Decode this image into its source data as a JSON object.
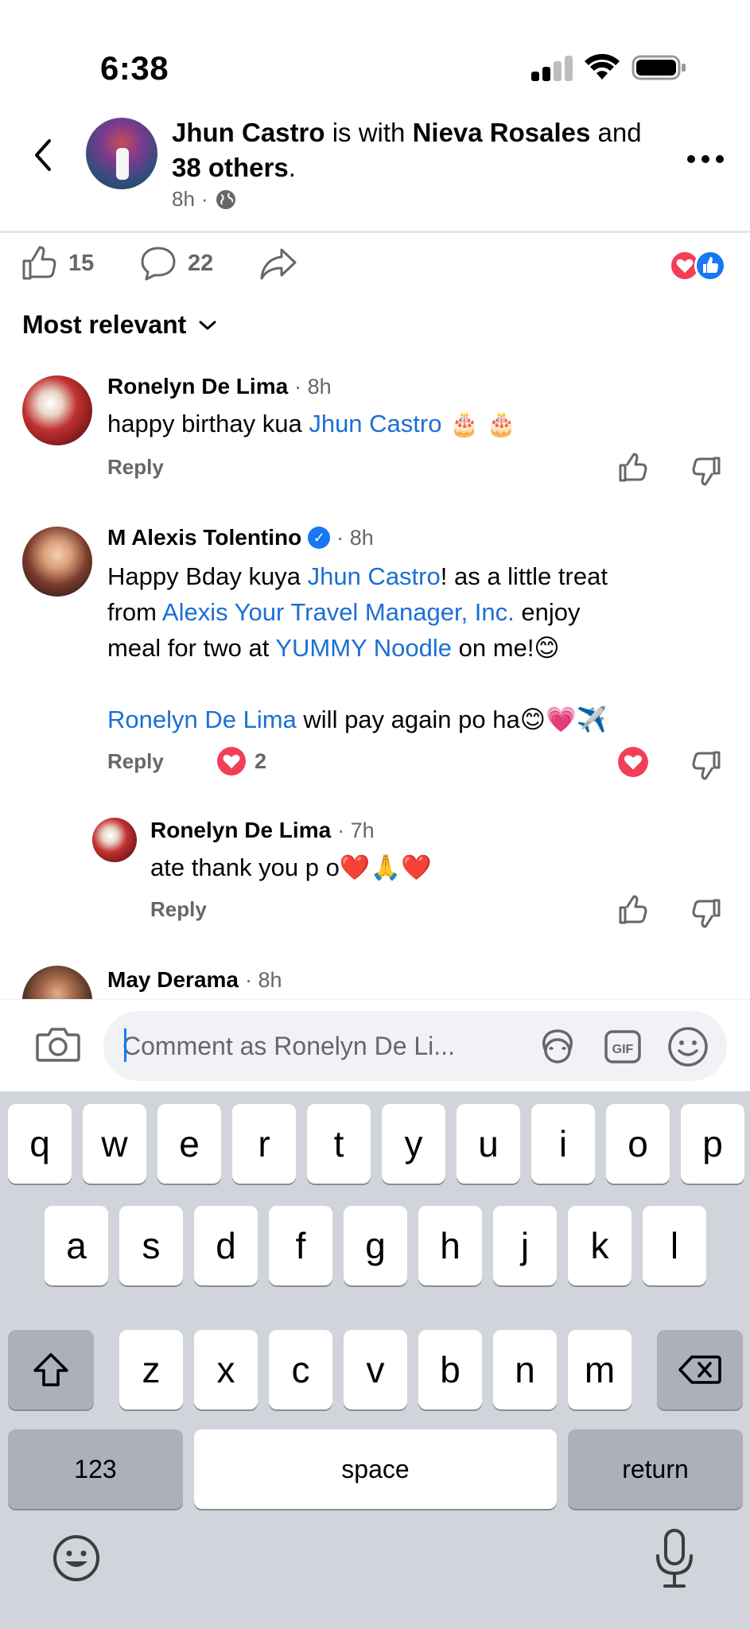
{
  "status_bar": {
    "time": "6:38"
  },
  "header": {
    "author": "Jhun Castro",
    "with_text": " is with ",
    "tagged": "Nieva Rosales",
    "and_text": " and ",
    "others": "38 others",
    "period": ".",
    "time": "8h",
    "separator": "·"
  },
  "actions": {
    "likes": "15",
    "comments": "22"
  },
  "sort": {
    "label": "Most relevant"
  },
  "comments": [
    {
      "name": "Ronelyn De Lima",
      "time": "· 8h",
      "text_before": "happy birthay kua ",
      "mention": "Jhun Castro",
      "emoji": " 🎂 🎂",
      "reply": "Reply"
    },
    {
      "name": "M Alexis Tolentino",
      "time": "· 8h",
      "line1_a": "Happy Bday kuya ",
      "line1_mention": "Jhun Castro",
      "line1_b": "! as a little treat",
      "line2_a": "from ",
      "line2_mention": "Alexis Your Travel Manager, Inc.",
      "line2_b": " enjoy",
      "line3_a": "meal for two at ",
      "line3_mention": "YUMMY Noodle",
      "line3_b": " on me!😊",
      "line4_mention": "Ronelyn De Lima",
      "line4_b": " will pay again po ha😊💗✈️",
      "reply": "Reply",
      "reactions": "2"
    },
    {
      "name": "Ronelyn De Lima",
      "time": "· 7h",
      "text": "ate thank you p o❤️🙏❤️",
      "reply": "Reply"
    },
    {
      "name": "May Derama",
      "time": "· 8h"
    }
  ],
  "composer": {
    "placeholder": "Comment as Ronelyn De Li..."
  },
  "keyboard": {
    "row1": [
      "q",
      "w",
      "e",
      "r",
      "t",
      "y",
      "u",
      "i",
      "o",
      "p"
    ],
    "row2": [
      "a",
      "s",
      "d",
      "f",
      "g",
      "h",
      "j",
      "k",
      "l"
    ],
    "row3": [
      "z",
      "x",
      "c",
      "v",
      "b",
      "n",
      "m"
    ],
    "numbers": "123",
    "space": "space",
    "return": "return"
  },
  "colors": {
    "link": "#1b6fd6",
    "accent": "#1877f2",
    "heart": "#f33e58",
    "keyboard_bg": "#d1d4db"
  }
}
